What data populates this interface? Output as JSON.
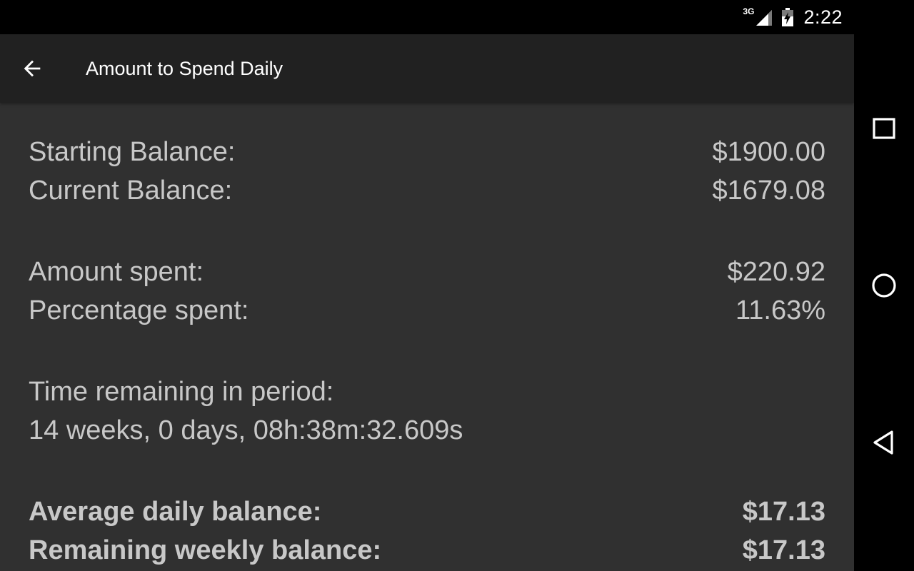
{
  "status_bar": {
    "network_label": "3G",
    "time": "2:22",
    "icons": [
      "signal-icon",
      "battery-charging-icon"
    ]
  },
  "app_bar": {
    "back_icon": "arrow-back-icon",
    "title": "Amount to Spend Daily"
  },
  "summary": {
    "starting_balance_label": "Starting Balance:",
    "starting_balance_value": "$1900.00",
    "current_balance_label": "Current Balance:",
    "current_balance_value": "$1679.08",
    "amount_spent_label": "Amount spent:",
    "amount_spent_value": "$220.92",
    "percentage_spent_label": "Percentage spent:",
    "percentage_spent_value": "11.63%",
    "time_remaining_label": "Time remaining in period:",
    "time_remaining_value": "14 weeks, 0 days, 08h:38m:32.609s",
    "average_daily_label": "Average daily balance:",
    "average_daily_value": "$17.13",
    "remaining_weekly_label": "Remaining weekly balance:",
    "remaining_weekly_value": "$17.13"
  },
  "nav_bar": {
    "icons": [
      "recents-icon",
      "home-icon",
      "back-icon"
    ]
  },
  "colors": {
    "status_bar": "#000000",
    "app_bar": "#212121",
    "content_bg": "#303030",
    "text_primary": "#c8c8c8",
    "title_text": "#ffffff"
  }
}
